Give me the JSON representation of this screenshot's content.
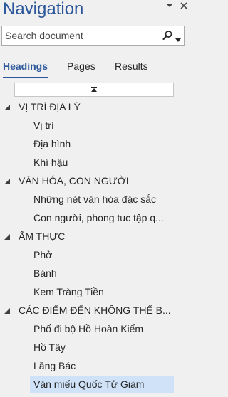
{
  "pane": {
    "title": "Navigation"
  },
  "search": {
    "placeholder": "Search document"
  },
  "tabs": [
    {
      "label": "Headings",
      "active": true
    },
    {
      "label": "Pages",
      "active": false
    },
    {
      "label": "Results",
      "active": false
    }
  ],
  "tree": [
    {
      "label": "VỊ TRÍ ĐỊA LÝ",
      "expanded": true,
      "children": [
        {
          "label": "Vị trí"
        },
        {
          "label": "Địa hình"
        },
        {
          "label": "Khí hậu"
        }
      ]
    },
    {
      "label": "VĂN HÓA, CON NGƯỜI",
      "expanded": true,
      "children": [
        {
          "label": "Những nét văn hóa đặc sắc"
        },
        {
          "label": "Con người, phong tuc tập q..."
        }
      ]
    },
    {
      "label": "ẨM THỰC",
      "expanded": true,
      "children": [
        {
          "label": "Phở"
        },
        {
          "label": "Bánh"
        },
        {
          "label": "Kem Tràng Tiền"
        }
      ]
    },
    {
      "label": "CÁC ĐIỂM ĐẾN KHÔNG THỂ B...",
      "expanded": true,
      "children": [
        {
          "label": "Phố đi bộ Hồ Hoàn Kiếm"
        },
        {
          "label": "Hồ Tây"
        },
        {
          "label": "Lăng Bác"
        },
        {
          "label": "Văn miếu Quốc Tử Giám",
          "selected": true
        }
      ]
    }
  ],
  "colors": {
    "accent": "#2b579a",
    "selection": "#cfe2f7",
    "background": "#f0f0f0"
  }
}
